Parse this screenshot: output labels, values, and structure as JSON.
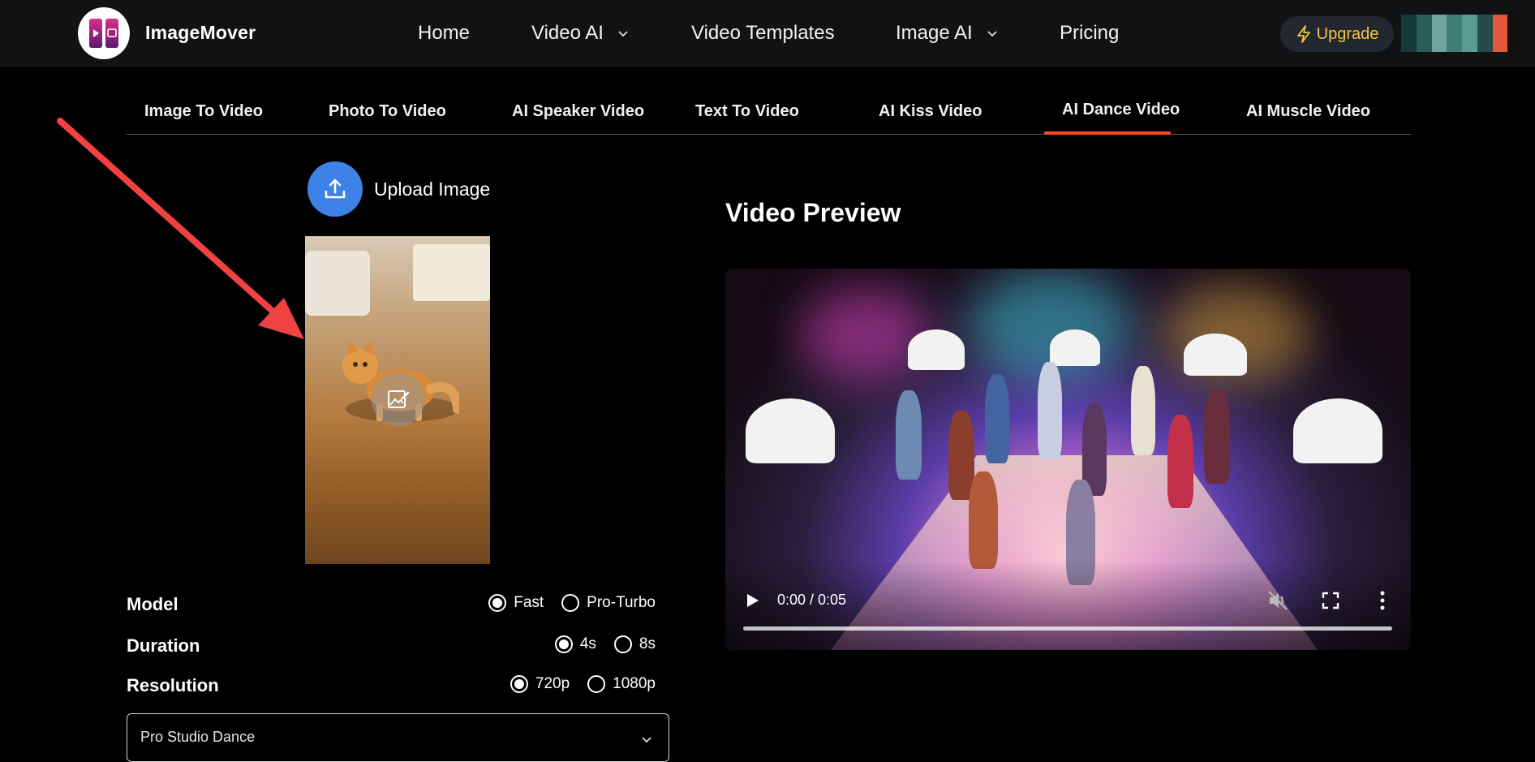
{
  "header": {
    "brand": "ImageMover",
    "nav": [
      {
        "label": "Home",
        "has_dropdown": false
      },
      {
        "label": "Video AI",
        "has_dropdown": true
      },
      {
        "label": "Video Templates",
        "has_dropdown": false
      },
      {
        "label": "Image AI",
        "has_dropdown": true
      },
      {
        "label": "Pricing",
        "has_dropdown": false
      }
    ],
    "upgrade_label": "Upgrade",
    "upgrade_color": "#f5c43d"
  },
  "tabs": {
    "items": [
      {
        "label": "Image To Video"
      },
      {
        "label": "Photo To Video"
      },
      {
        "label": "AI Speaker Video"
      },
      {
        "label": "Text To Video"
      },
      {
        "label": "AI Kiss Video"
      },
      {
        "label": "AI Dance Video"
      },
      {
        "label": "AI Muscle Video"
      }
    ],
    "active_index": 5,
    "accent": "#ff4b1f"
  },
  "upload": {
    "label": "Upload Image",
    "icon": "upload-icon",
    "color": "#3d82e6"
  },
  "options": {
    "model": {
      "label": "Model",
      "choices": [
        {
          "label": "Fast",
          "checked": true
        },
        {
          "label": "Pro-Turbo",
          "checked": false
        }
      ]
    },
    "duration": {
      "label": "Duration",
      "choices": [
        {
          "label": "4s",
          "checked": true
        },
        {
          "label": "8s",
          "checked": false
        }
      ]
    },
    "resolution": {
      "label": "Resolution",
      "choices": [
        {
          "label": "720p",
          "checked": true
        },
        {
          "label": "1080p",
          "checked": false
        }
      ]
    }
  },
  "template_select": {
    "value": "Pro Studio Dance"
  },
  "preview": {
    "title": "Video Preview",
    "time": "0:00 / 0:05",
    "progress": 0
  }
}
